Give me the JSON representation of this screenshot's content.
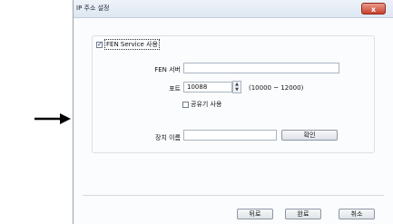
{
  "window": {
    "title": "IP 주소 설정",
    "close_label": "x"
  },
  "fen_service": {
    "label": "FEN Service 사용",
    "checked": true
  },
  "fen_server": {
    "label": "FEN 서버",
    "value": ""
  },
  "port": {
    "label": "포트",
    "value": "10088",
    "range": "(10000 ~ 12000)"
  },
  "router_share": {
    "label": "공유기 사용",
    "checked": false
  },
  "device_name": {
    "label": "장치 이름",
    "value": "",
    "confirm_label": "확인"
  },
  "footer": {
    "back_label": "뒤로",
    "finish_label": "완료",
    "cancel_label": "취소"
  },
  "icons": {
    "pointer": "arrow-right-icon",
    "spin_up": "chevron-up-icon",
    "spin_down": "chevron-down-icon"
  }
}
